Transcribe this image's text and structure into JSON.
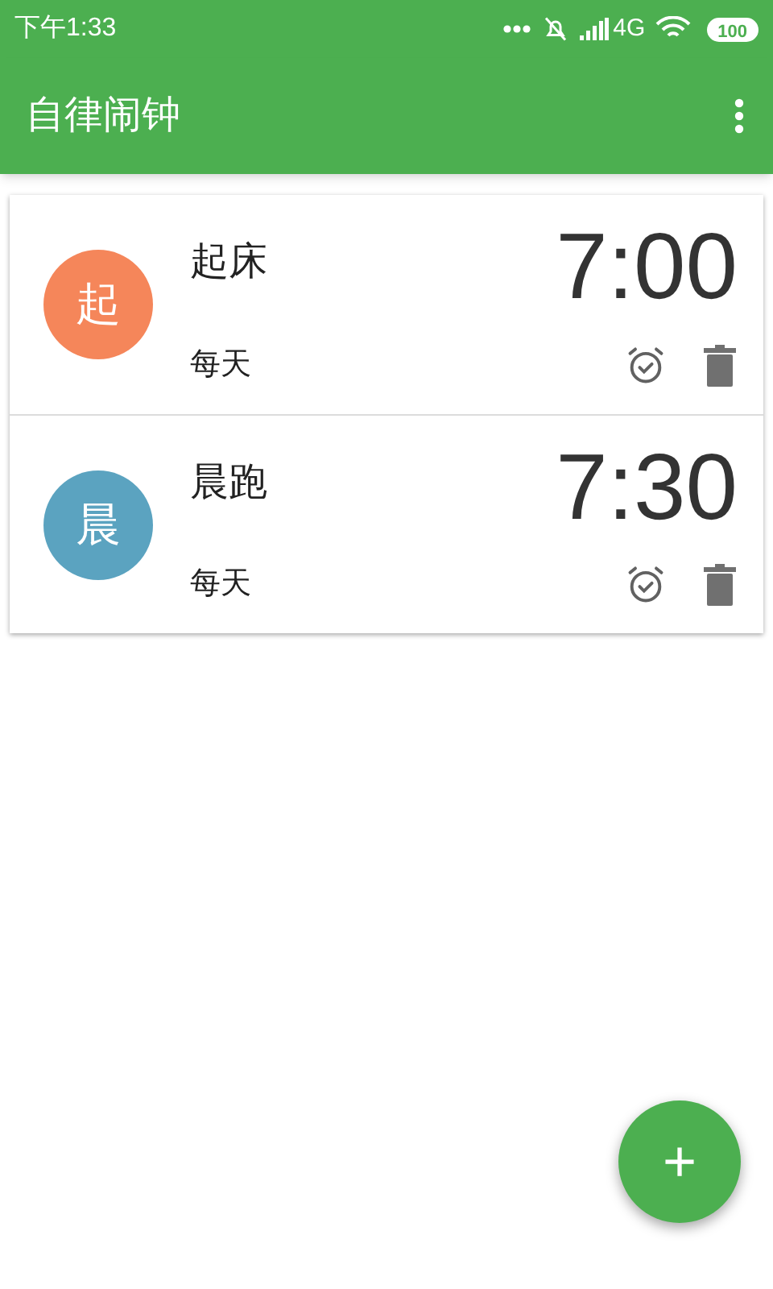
{
  "status_bar": {
    "time": "下午1:33",
    "network": "4G",
    "battery": "100"
  },
  "app_bar": {
    "title": "自律闹钟"
  },
  "alarms": [
    {
      "avatar": "起",
      "color": "#f5865a",
      "name": "起床",
      "time": "7:00",
      "repeat": "每天"
    },
    {
      "avatar": "晨",
      "color": "#5ba3c0",
      "name": "晨跑",
      "time": "7:30",
      "repeat": "每天"
    }
  ],
  "fab": {
    "label": "+"
  }
}
